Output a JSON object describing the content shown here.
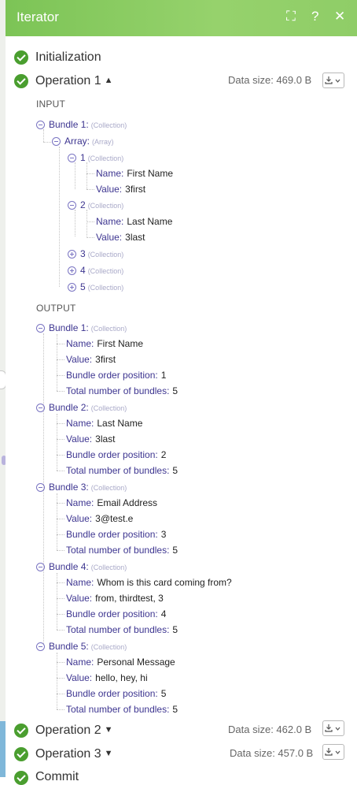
{
  "window": {
    "title": "Iterator"
  },
  "header_icons": [
    "expand-icon",
    "help-icon",
    "close-icon"
  ],
  "header_glyphs": {
    "expand": "⛶",
    "help": "?",
    "close": "✕"
  },
  "colors": {
    "header": "#8bcb62",
    "check": "#4a9e2f",
    "key": "#3d3590",
    "toggle": "#7a74c2"
  },
  "init_label": "Initialization",
  "op1": {
    "label": "Operation 1",
    "caret": "▲",
    "data_size": "Data size: 469.0 B"
  },
  "op2": {
    "label": "Operation 2",
    "caret": "▼",
    "data_size": "Data size: 462.0 B"
  },
  "op3": {
    "label": "Operation 3",
    "caret": "▼",
    "data_size": "Data size: 457.0 B"
  },
  "commit_label": "Commit",
  "input": {
    "title": "INPUT",
    "bundle_key": "Bundle 1:",
    "bundle_type": "(Collection)",
    "array_key": "Array:",
    "array_type": "(Array)",
    "items": [
      {
        "key": "1",
        "type": "(Collection)",
        "name_key": "Name:",
        "name": "First Name",
        "value_key": "Value:",
        "value": "3first"
      },
      {
        "key": "2",
        "type": "(Collection)",
        "name_key": "Name:",
        "name": "Last Name",
        "value_key": "Value:",
        "value": "3last"
      },
      {
        "key": "3",
        "type": "(Collection)"
      },
      {
        "key": "4",
        "type": "(Collection)"
      },
      {
        "key": "5",
        "type": "(Collection)"
      }
    ]
  },
  "output": {
    "title": "OUTPUT",
    "bundles": [
      {
        "key": "Bundle 1:",
        "type": "(Collection)",
        "name_key": "Name:",
        "name": "First Name",
        "value_key": "Value:",
        "value": "3first",
        "pos_key": "Bundle order position:",
        "pos": "1",
        "total_key": "Total number of bundles:",
        "total": "5"
      },
      {
        "key": "Bundle 2:",
        "type": "(Collection)",
        "name_key": "Name:",
        "name": "Last Name",
        "value_key": "Value:",
        "value": "3last",
        "pos_key": "Bundle order position:",
        "pos": "2",
        "total_key": "Total number of bundles:",
        "total": "5"
      },
      {
        "key": "Bundle 3:",
        "type": "(Collection)",
        "name_key": "Name:",
        "name": "Email Address",
        "value_key": "Value:",
        "value": "3@test.e",
        "pos_key": "Bundle order position:",
        "pos": "3",
        "total_key": "Total number of bundles:",
        "total": "5"
      },
      {
        "key": "Bundle 4:",
        "type": "(Collection)",
        "name_key": "Name:",
        "name": "Whom is this card coming from?",
        "value_key": "Value:",
        "value": "from, thirdtest, 3",
        "pos_key": "Bundle order position:",
        "pos": "4",
        "total_key": "Total number of bundles:",
        "total": "5"
      },
      {
        "key": "Bundle 5:",
        "type": "(Collection)",
        "name_key": "Name:",
        "name": "Personal Message",
        "value_key": "Value:",
        "value": "hello, hey, hi",
        "pos_key": "Bundle order position:",
        "pos": "5",
        "total_key": "Total number of bundles:",
        "total": "5"
      }
    ]
  }
}
